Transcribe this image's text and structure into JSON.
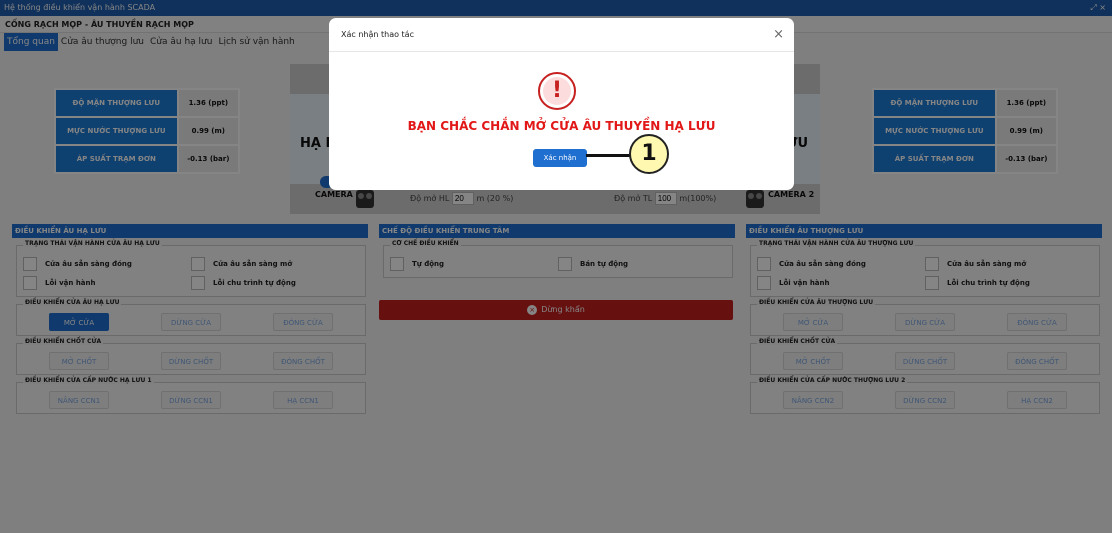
{
  "window": {
    "title": "Hệ thống điều khiển vận hành SCADA",
    "controls": "⤢ ×"
  },
  "app": {
    "header": "CỐNG RẠCH MỌP - ÂU THUYỀN RẠCH MỌP"
  },
  "tabs": [
    {
      "label": "Tổng quan",
      "active": true
    },
    {
      "label": "Cửa âu thượng lưu"
    },
    {
      "label": "Cửa âu hạ lưu"
    },
    {
      "label": "Lịch sử vận hành"
    }
  ],
  "left_info": [
    {
      "key": "ĐỘ MẶN THƯỢNG LƯU",
      "value": "1.36 (ppt)"
    },
    {
      "key": "MỰC NƯỚC THƯỢNG LƯU",
      "value": "0.99 (m)"
    },
    {
      "key": "ÁP SUẤT TRẠM ĐƠN",
      "value": "-0.13 (bar)"
    }
  ],
  "right_info": [
    {
      "key": "ĐỘ MẶN THƯỢNG LƯU",
      "value": "1.36 (ppt)"
    },
    {
      "key": "MỰC NƯỚC THƯỢNG LƯU",
      "value": "0.99 (m)"
    },
    {
      "key": "ÁP SUẤT TRẠM ĐƠN",
      "value": "-0.13 (bar)"
    }
  ],
  "scene": {
    "left_label": "HẠ L",
    "right_label": "LƯU",
    "camera1": "CAMERA 1",
    "camera2": "CAMERA 2",
    "hl_open_label": "Độ mở HL",
    "hl_open_value": "20",
    "hl_open_unit": "m (20 %)",
    "tl_open_label": "Độ mở TL",
    "tl_open_value": "100",
    "tl_open_unit": "m(100%)"
  },
  "panel_left": {
    "title": "ĐIỀU KHIỂN ÂU HẠ LƯU",
    "status_group": "TRẠNG THÁI VẬN HÀNH CỬA ÂU HẠ LƯU",
    "status_items": [
      "Cửa âu sẵn sàng đóng",
      "Cửa âu sẵn sàng mở",
      "Lỗi vận hành",
      "Lỗi chu trình tự động"
    ],
    "gate_group": "ĐIỀU KHIỂN CỬA ÂU HẠ LƯU",
    "gate_buttons": [
      "MỞ CỬA",
      "DỪNG CỬA",
      "ĐÓNG CỬA"
    ],
    "latch_group": "ĐIỀU KHIỂN CHỐT CỬA",
    "latch_buttons": [
      "MỞ CHỐT",
      "DỪNG CHỐT",
      "ĐÓNG CHỐT"
    ],
    "feed_group": "ĐIỀU KHIỂN CỬA CẤP NƯỚC HẠ LƯU 1",
    "feed_buttons": [
      "NÂNG CCN1",
      "DỪNG CCN1",
      "HẠ CCN1"
    ]
  },
  "panel_center": {
    "title": "CHẾ ĐỘ ĐIỀU KHIỂN TRUNG TÂM",
    "mode_group": "CƠ CHẾ ĐIỀU KHIỂN",
    "modes": [
      "Tự động",
      "Bán tự động"
    ],
    "estop": "Dừng khẩn"
  },
  "panel_right": {
    "title": "ĐIỀU KHIỂN ÂU THƯỢNG LƯU",
    "status_group": "TRẠNG THÁI VẬN HÀNH CỬA ÂU THƯỢNG LƯU",
    "status_items": [
      "Cửa âu sẵn sàng đóng",
      "Cửa âu sẵn sàng mở",
      "Lỗi vận hành",
      "Lỗi chu trình tự động"
    ],
    "gate_group": "ĐIỀU KHIỂN CỬA ÂU THƯỢNG LƯU",
    "gate_buttons": [
      "MỞ CỬA",
      "DỪNG CỬA",
      "ĐÓNG CỬA"
    ],
    "latch_group": "ĐIỀU KHIỂN CHỐT CỬA",
    "latch_buttons": [
      "MỞ CHỐT",
      "DỪNG CHỐT",
      "ĐÓNG CHỐT"
    ],
    "feed_group": "ĐIỀU KHIỂN CỬA CẤP NƯỚC THƯỢNG LƯU 2",
    "feed_buttons": [
      "NÂNG CCN2",
      "DỪNG CCN2",
      "HẠ CCN2"
    ]
  },
  "modal": {
    "title": "Xác nhận thao tác",
    "close": "×",
    "icon": "exclamation-icon",
    "icon_glyph": "!",
    "message": "BẠN CHẮC CHẮN MỞ CỬA ÂU THUYỀN HẠ LƯU",
    "confirm": "Xác nhận"
  },
  "callout": {
    "number": "1"
  }
}
